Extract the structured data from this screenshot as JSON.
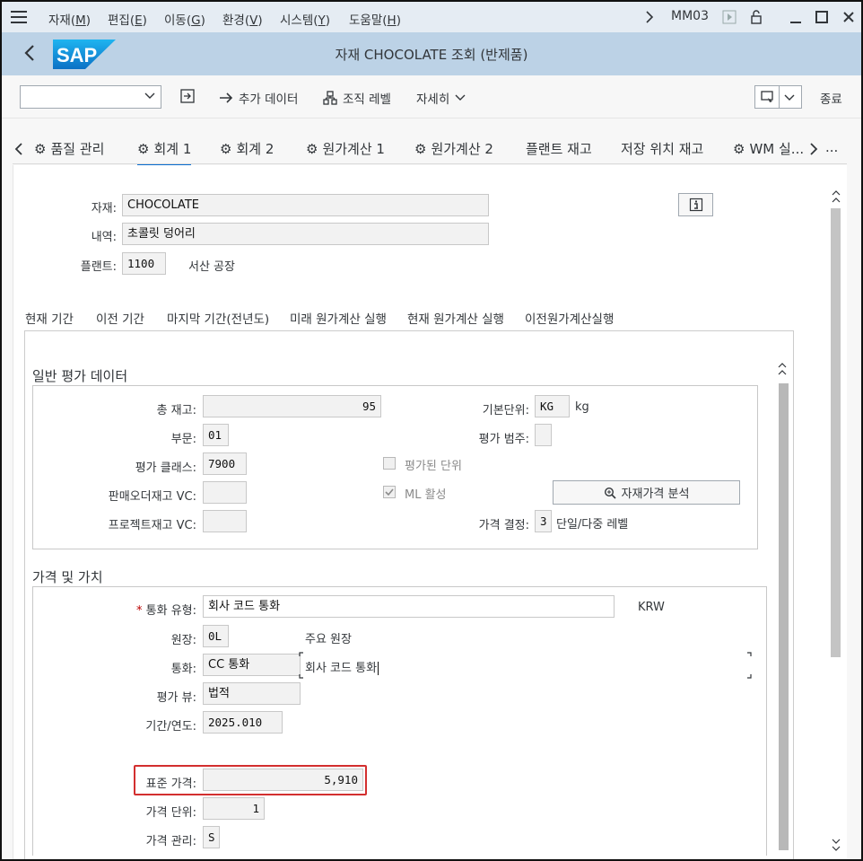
{
  "menubar": {
    "items": [
      "자재(M)",
      "편집(E)",
      "이동(G)",
      "환경(V)",
      "시스템(Y)",
      "도움말(H)"
    ],
    "transaction": "MM03"
  },
  "titlebar": {
    "logo": "SAP",
    "title": "자재 CHOCOLATE 조회 (반제품)"
  },
  "toolbar": {
    "additional_data": "추가 데이터",
    "org_levels": "조직 레벨",
    "details": "자세히",
    "exit": "종료"
  },
  "tabs": [
    "품질 관리",
    "회계 1",
    "회계 2",
    "원가계산 1",
    "원가계산 2",
    "플랜트 재고",
    "저장 위치 재고",
    "WM 실..."
  ],
  "tabs_more": "...",
  "header": {
    "material_label": "자재:",
    "material_value": "CHOCOLATE",
    "description_label": "내역:",
    "description_value": "초콜릿 덩어리",
    "plant_label": "플랜트:",
    "plant_value": "1100",
    "plant_name": "서산 공장"
  },
  "subtabs": [
    "현재 기간",
    "이전 기간",
    "마지막 기간(전년도)",
    "미래 원가계산 실행",
    "현재 원가계산 실행",
    "이전원가계산실행"
  ],
  "general_valuation": {
    "title": "일반 평가 데이터",
    "total_stock_label": "총 재고:",
    "total_stock_value": "95",
    "base_unit_label": "기본단위:",
    "base_unit_value": "KG",
    "base_unit_text": "kg",
    "division_label": "부문:",
    "division_value": "01",
    "valuation_category_label": "평가 범주:",
    "valuation_category_value": "",
    "valuation_class_label": "평가 클래스:",
    "valuation_class_value": "7900",
    "valuated_unit_label": "평가된 단위",
    "sales_order_stock_label": "판매오더재고 VC:",
    "sales_order_stock_value": "",
    "ml_active_label": "ML 활성",
    "ml_active_checked": true,
    "material_price_analysis": "자재가격 분석",
    "project_stock_label": "프로젝트재고 VC:",
    "project_stock_value": "",
    "price_determination_label": "가격 결정:",
    "price_determination_value": "3",
    "price_determination_text": "단일/다중 레벨"
  },
  "price_values": {
    "title": "가격 및 가치",
    "currency_type_label": "통화 유형:",
    "currency_type_value": "회사 코드 통화",
    "currency_code": "KRW",
    "ledger_label": "원장:",
    "ledger_value": "0L",
    "ledger_text": "주요 원장",
    "currency_label": "통화:",
    "currency_value": "CC 통화",
    "currency_text": "회사 코드 통화",
    "valuation_view_label": "평가 뷰:",
    "valuation_view_value": "법적",
    "period_label": "기간/연도:",
    "period_value": "2025.010",
    "standard_price_label": "표준 가격:",
    "standard_price_value": "5,910",
    "price_unit_label": "가격 단위:",
    "price_unit_value": "1",
    "price_control_label": "가격 관리:",
    "price_control_value": "S"
  }
}
